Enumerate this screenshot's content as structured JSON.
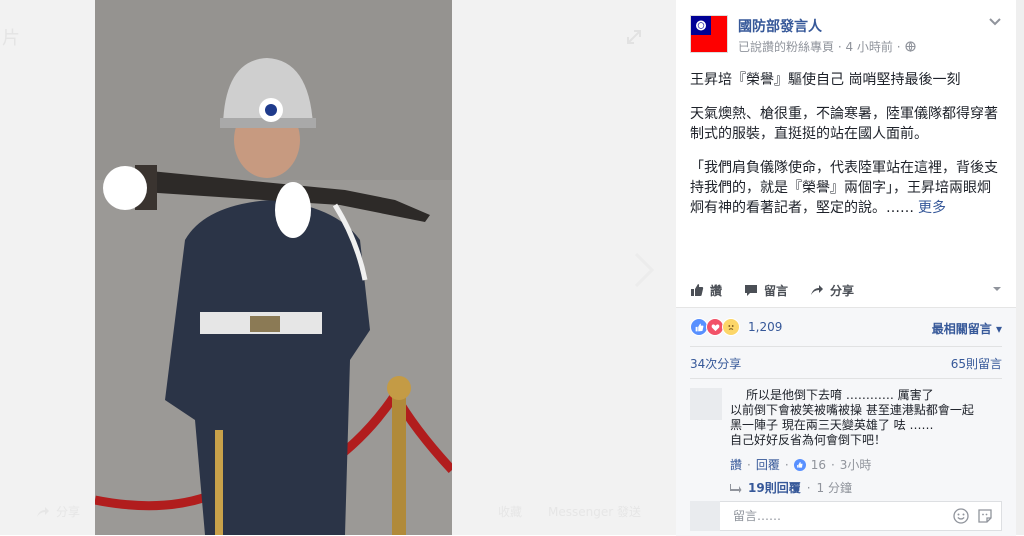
{
  "viewer": {
    "top_label": "片",
    "share_label": "分享",
    "messenger_label": "Messenger 發送",
    "dim_label": "收藏"
  },
  "post": {
    "page_name": "國防部發言人",
    "meta_text": "已說讚的粉絲專頁 · 4 小時前 ·",
    "paragraphs": [
      "王昇培『榮譽』驅使自己 崗哨堅持最後一刻",
      "天氣燠熱、槍很重，不論寒暑，陸軍儀隊都得穿著制式的服裝，直挺挺的站在國人面前。",
      "「我們肩負儀隊使命，代表陸軍站在這裡，背後支持我們的，就是『榮譽』兩個字」，王昇培兩眼炯炯有神的看著記者，堅定的說。……"
    ],
    "see_more": "更多",
    "actions": {
      "like": "讚",
      "comment": "留言",
      "share": "分享"
    },
    "reaction_count": "1,209",
    "top_comments_label": "最相關留言",
    "share_count": "34次分享",
    "comment_count": "65則留言"
  },
  "comment": {
    "lines": [
      "所以是他倒下去唷 ………… 厲害了",
      "以前倒下會被笑被嘴被操 甚至連港點都會一起",
      "黑一陣子 現在兩三天變英雄了 呿 ……",
      "自己好好反省為何會倒下吧！"
    ],
    "like_label": "讚",
    "reply_label": "回覆",
    "likes": "16",
    "time": "3小時",
    "replies_label": "19則回覆",
    "replies_time": "1 分鐘"
  },
  "composer": {
    "placeholder": "留言……"
  },
  "colors": {
    "link": "#365899",
    "text": "#1d2129",
    "muted": "#90949c",
    "like_blue": "#5890ff",
    "love_red": "#f25268"
  }
}
